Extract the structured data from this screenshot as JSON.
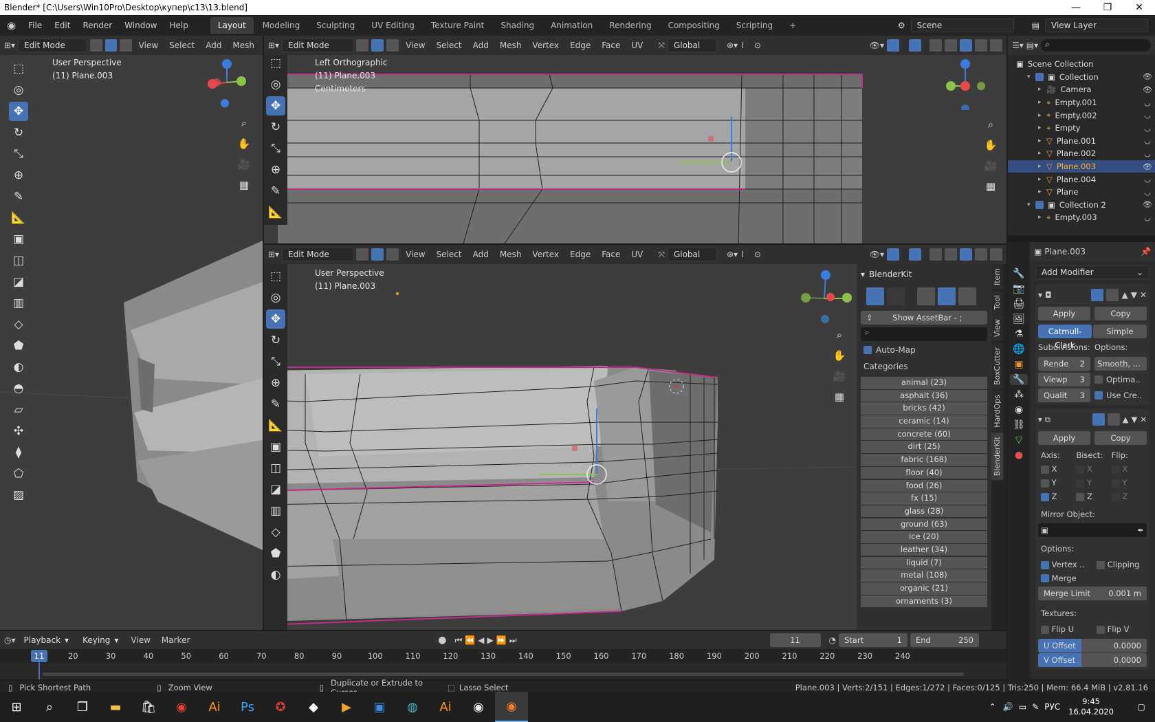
{
  "window": {
    "title": "Blender* [C:\\Users\\Win10Pro\\Desktop\\купер\\с13\\13.blend]",
    "min": "—",
    "max": "❐",
    "close": "✕"
  },
  "menu": {
    "logo": "◉",
    "items": [
      "File",
      "Edit",
      "Render",
      "Window",
      "Help"
    ]
  },
  "workspaces": {
    "tabs": [
      "Layout",
      "Modeling",
      "Sculpting",
      "UV Editing",
      "Texture Paint",
      "Shading",
      "Animation",
      "Rendering",
      "Compositing",
      "Scripting"
    ],
    "active": "Layout",
    "add": "+"
  },
  "scene": {
    "label": "Scene",
    "view_layer": "View Layer"
  },
  "left_view": {
    "mode": "Edit Mode",
    "menus": [
      "View",
      "Select",
      "Add",
      "Mesh"
    ],
    "perspective": "User Perspective",
    "object": "(11) Plane.003"
  },
  "top_view": {
    "mode": "Edit Mode",
    "menus": [
      "View",
      "Select",
      "Add",
      "Mesh",
      "Vertex",
      "Edge",
      "Face",
      "UV"
    ],
    "orientation": "Global",
    "perspective": "Left Orthographic",
    "object": "(11) Plane.003",
    "units": "Centimeters"
  },
  "main_view": {
    "mode": "Edit Mode",
    "menus": [
      "View",
      "Select",
      "Add",
      "Mesh",
      "Vertex",
      "Edge",
      "Face",
      "UV"
    ],
    "orientation": "Global",
    "perspective": "User Perspective",
    "object": "(11) Plane.003"
  },
  "gizmo": {
    "x": "X",
    "y": "Y",
    "z": "Z"
  },
  "blenderkit": {
    "title": "BlenderKit",
    "show_assetbar": "Show AssetBar - ;",
    "automap": "Auto-Map",
    "categories_label": "Categories",
    "categories": [
      "animal (23)",
      "asphalt (36)",
      "bricks (42)",
      "ceramic (14)",
      "concrete (60)",
      "dirt (25)",
      "fabric (168)",
      "floor (40)",
      "food (26)",
      "fx (15)",
      "glass (28)",
      "ground (63)",
      "ice (20)",
      "leather (34)",
      "liquid (7)",
      "metal (108)",
      "organic (21)",
      "ornaments (3)"
    ],
    "vtabs": [
      "Item",
      "Tool",
      "View",
      "BoxCutter",
      "HardOps",
      "BlenderKit"
    ]
  },
  "outliner": {
    "scene_collection": "Scene Collection",
    "rows": [
      {
        "name": "Collection",
        "indent": 1,
        "type": "collection"
      },
      {
        "name": "Camera",
        "indent": 2,
        "type": "camera"
      },
      {
        "name": "Empty.001",
        "indent": 2,
        "type": "empty"
      },
      {
        "name": "Empty.002",
        "indent": 2,
        "type": "empty"
      },
      {
        "name": "Empty",
        "indent": 2,
        "type": "empty"
      },
      {
        "name": "Plane.001",
        "indent": 2,
        "type": "mesh"
      },
      {
        "name": "Plane.002",
        "indent": 2,
        "type": "mesh"
      },
      {
        "name": "Plane.003",
        "indent": 2,
        "type": "mesh",
        "selected": true
      },
      {
        "name": "Plane.004",
        "indent": 2,
        "type": "mesh"
      },
      {
        "name": "Plane",
        "indent": 2,
        "type": "mesh"
      },
      {
        "name": "Collection 2",
        "indent": 1,
        "type": "collection"
      },
      {
        "name": "Empty.003",
        "indent": 2,
        "type": "empty"
      }
    ]
  },
  "properties": {
    "object": "Plane.003",
    "add_modifier": "Add Modifier",
    "subsurf": {
      "apply": "Apply",
      "copy": "Copy",
      "catmull": "Catmull-Clark",
      "simple": "Simple",
      "subdivisions": "Subdivisions:",
      "options": "Options:",
      "render": "Rende",
      "render_val": "2",
      "viewport": "Viewp",
      "viewport_val": "3",
      "quality": "Qualit",
      "quality_val": "3",
      "smooth": "Smooth, ...",
      "optimal": "Optima..",
      "use_crease": "Use Cre.."
    },
    "mirror": {
      "apply": "Apply",
      "copy": "Copy",
      "axis": "Axis:",
      "bisect": "Bisect:",
      "flip": "Flip:",
      "x": "X",
      "y": "Y",
      "z": "Z",
      "mirror_object": "Mirror Object:",
      "options": "Options:",
      "vertex": "Vertex ..",
      "clipping": "Clipping",
      "merge": "Merge",
      "merge_limit": "Merge Limit",
      "merge_limit_val": "0.001 m",
      "textures": "Textures:",
      "flip_u": "Flip U",
      "flip_v": "Flip V",
      "u_offset": "U Offset",
      "u_offset_val": "0.0000",
      "v_offset": "V Offset",
      "v_offset_val": "0.0000"
    }
  },
  "timeline": {
    "menus": [
      "Playback",
      "Keying",
      "View",
      "Marker"
    ],
    "frame": "11",
    "start_label": "Start",
    "start": "1",
    "end_label": "End",
    "end": "250",
    "current": "11",
    "ticks": [
      "20",
      "30",
      "40",
      "50",
      "60",
      "70",
      "80",
      "90",
      "100",
      "110",
      "120",
      "130",
      "140",
      "150",
      "160",
      "170",
      "180",
      "190",
      "200",
      "210",
      "220",
      "230",
      "240"
    ]
  },
  "status": {
    "pick": "Pick Shortest Path",
    "zoom": "Zoom View",
    "duplicate": "Duplicate or Extrude to Cursor",
    "lasso": "Lasso Select",
    "info": "Plane.003 | Verts:2/151 | Edges:1/272 | Faces:0/125 | Tris:250 | Mem: 66.4 MiB | v2.81.16"
  },
  "taskbar": {
    "lang": "РУС",
    "time": "9:45",
    "date": "16.04.2020"
  }
}
